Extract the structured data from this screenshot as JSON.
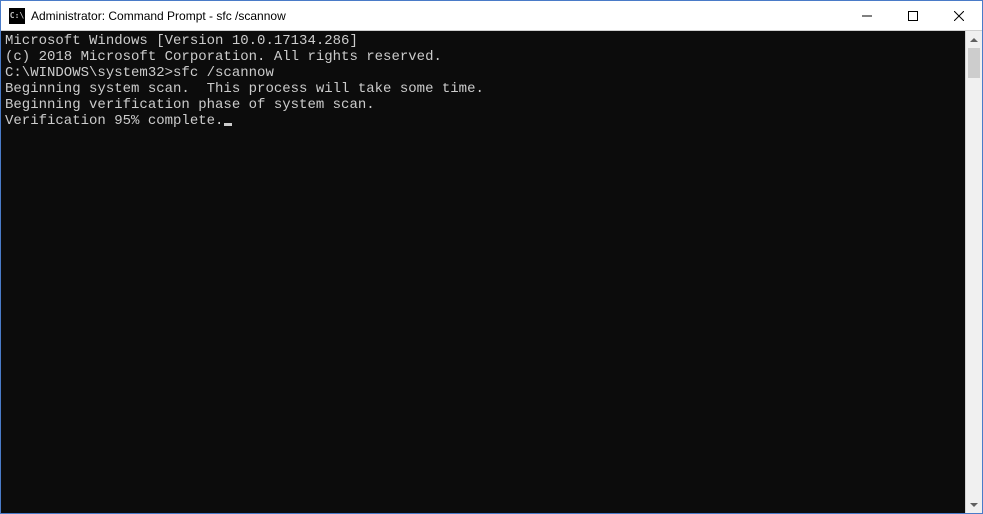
{
  "window": {
    "title": "Administrator: Command Prompt - sfc  /scannow",
    "icon_text": "C:\\"
  },
  "terminal": {
    "line1": "Microsoft Windows [Version 10.0.17134.286]",
    "line2": "(c) 2018 Microsoft Corporation. All rights reserved.",
    "blank1": "",
    "prompt_line": "C:\\WINDOWS\\system32>sfc /scannow",
    "blank2": "",
    "beginning_scan": "Beginning system scan.  This process will take some time.",
    "blank3": "",
    "beginning_verify": "Beginning verification phase of system scan.",
    "verification": "Verification 95% complete."
  }
}
